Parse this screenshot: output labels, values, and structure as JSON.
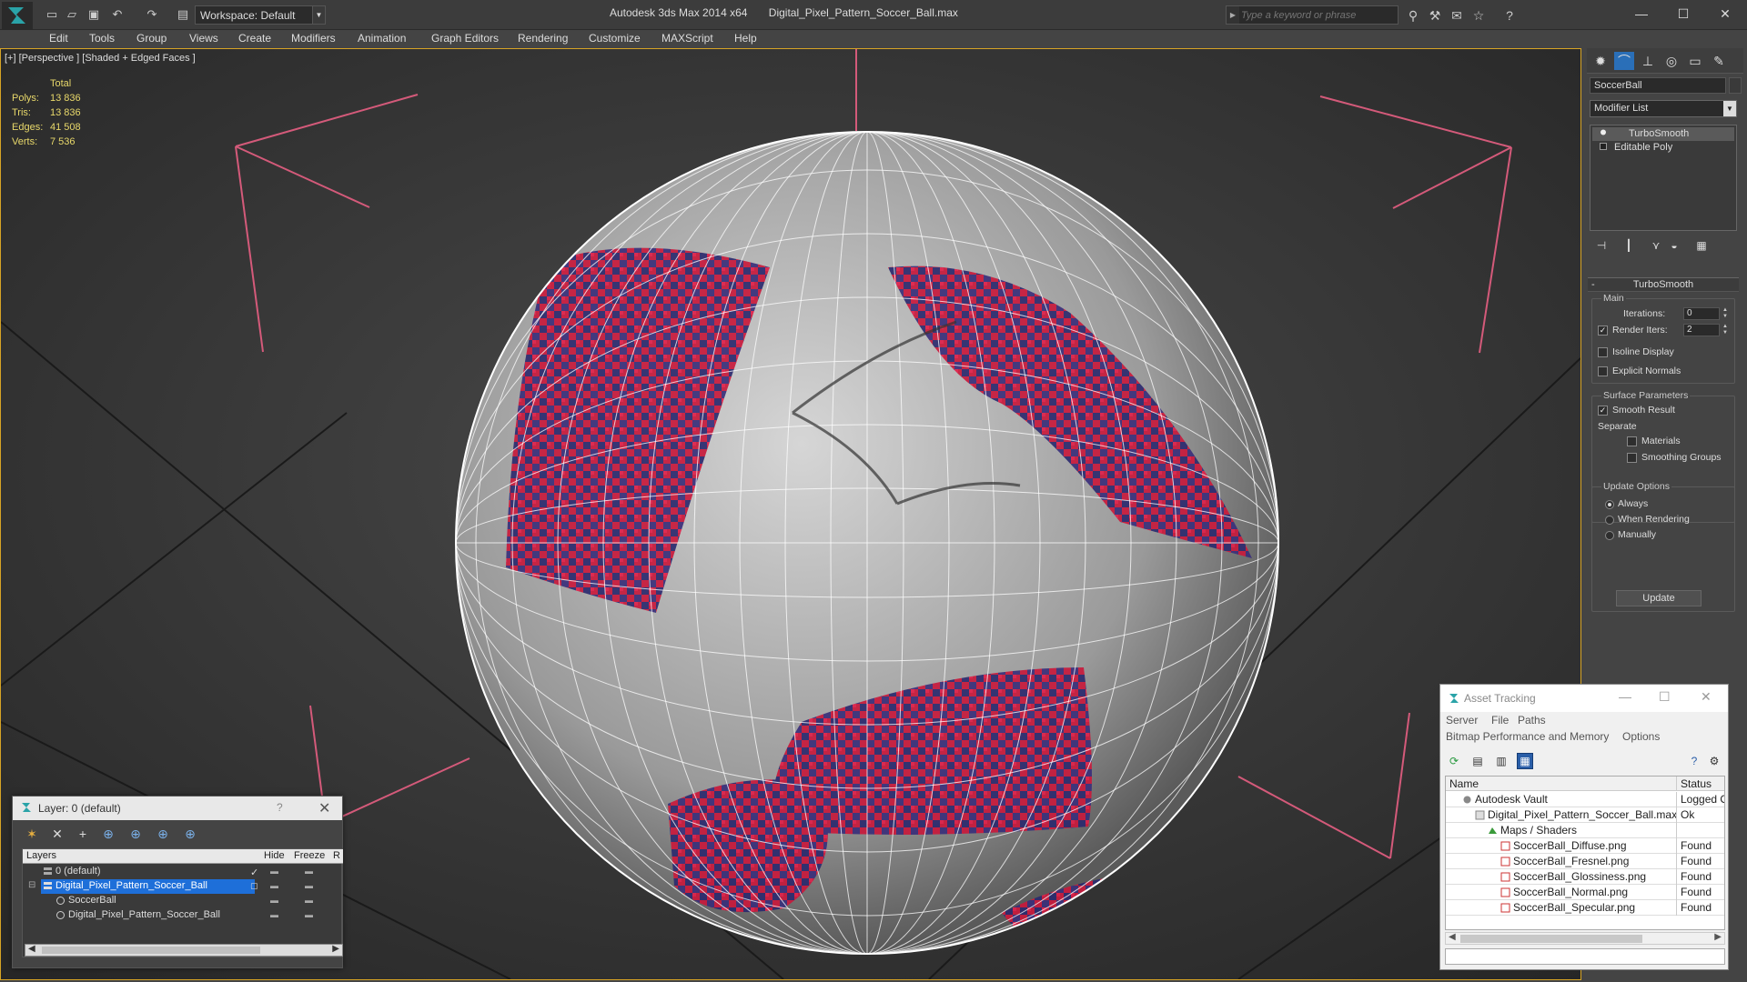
{
  "titlebar": {
    "workspace": "Workspace: Default",
    "app_title": "Autodesk 3ds Max  2014 x64",
    "file_title": "Digital_Pixel_Pattern_Soccer_Ball.max",
    "search_placeholder": "Type a keyword or phrase"
  },
  "menu": [
    "Edit",
    "Tools",
    "Group",
    "Views",
    "Create",
    "Modifiers",
    "Animation",
    "Graph Editors",
    "Rendering",
    "Customize",
    "MAXScript",
    "Help"
  ],
  "viewport": {
    "label": "[+] [Perspective ] [Shaded + Edged Faces ]",
    "stats_header": "Total",
    "stats": [
      {
        "k": "Polys:",
        "v": "13 836"
      },
      {
        "k": "Tris:",
        "v": "13 836"
      },
      {
        "k": "Edges:",
        "v": "41 508"
      },
      {
        "k": "Verts:",
        "v": "7 536"
      }
    ]
  },
  "command_panel": {
    "object_name": "SoccerBall",
    "modifier_list": "Modifier List",
    "stack": [
      "TurboSmooth",
      "Editable Poly"
    ],
    "rollout_title": "TurboSmooth",
    "main_group": "Main",
    "iterations_label": "Iterations:",
    "iterations_value": "0",
    "render_iters_label": "Render Iters:",
    "render_iters_value": "2",
    "render_iters_checked": true,
    "isoline_label": "Isoline Display",
    "explicit_normals_label": "Explicit Normals",
    "surface_group": "Surface Parameters",
    "smooth_result_label": "Smooth Result",
    "separate_label": "Separate",
    "materials_label": "Materials",
    "smoothing_groups_label": "Smoothing Groups",
    "update_group": "Update Options",
    "always_label": "Always",
    "when_rendering_label": "When Rendering",
    "manually_label": "Manually",
    "update_button": "Update"
  },
  "layer_dialog": {
    "title": "Layer: 0 (default)",
    "help": "?",
    "headers": {
      "layers": "Layers",
      "hide": "Hide",
      "freeze": "Freeze",
      "r": "R"
    },
    "rows": [
      {
        "name": "0 (default)",
        "indent": 1
      },
      {
        "name": "Digital_Pixel_Pattern_Soccer_Ball",
        "indent": 1
      },
      {
        "name": "SoccerBall",
        "indent": 2
      },
      {
        "name": "Digital_Pixel_Pattern_Soccer_Ball",
        "indent": 2
      }
    ]
  },
  "asset_dialog": {
    "title": "Asset Tracking",
    "menu1": [
      "Server",
      "File",
      "Paths"
    ],
    "menu2": [
      "Bitmap Performance and Memory",
      "Options"
    ],
    "headers": {
      "name": "Name",
      "status": "Status"
    },
    "rows": [
      {
        "name": "Autodesk Vault",
        "status": "Logged O",
        "indent": 1
      },
      {
        "name": "Digital_Pixel_Pattern_Soccer_Ball.max",
        "status": "Ok",
        "indent": 2
      },
      {
        "name": "Maps / Shaders",
        "status": "",
        "indent": 3
      },
      {
        "name": "SoccerBall_Diffuse.png",
        "status": "Found",
        "indent": 4
      },
      {
        "name": "SoccerBall_Fresnel.png",
        "status": "Found",
        "indent": 4
      },
      {
        "name": "SoccerBall_Glossiness.png",
        "status": "Found",
        "indent": 4
      },
      {
        "name": "SoccerBall_Normal.png",
        "status": "Found",
        "indent": 4
      },
      {
        "name": "SoccerBall_Specular.png",
        "status": "Found",
        "indent": 4
      }
    ]
  },
  "colors": {
    "viewport_border": "#d7a425",
    "stats_text": "#e8d86a",
    "ball_red": "#d8183a",
    "ball_navy": "#2c2a6e",
    "selection_blue": "#1e6fd9"
  }
}
